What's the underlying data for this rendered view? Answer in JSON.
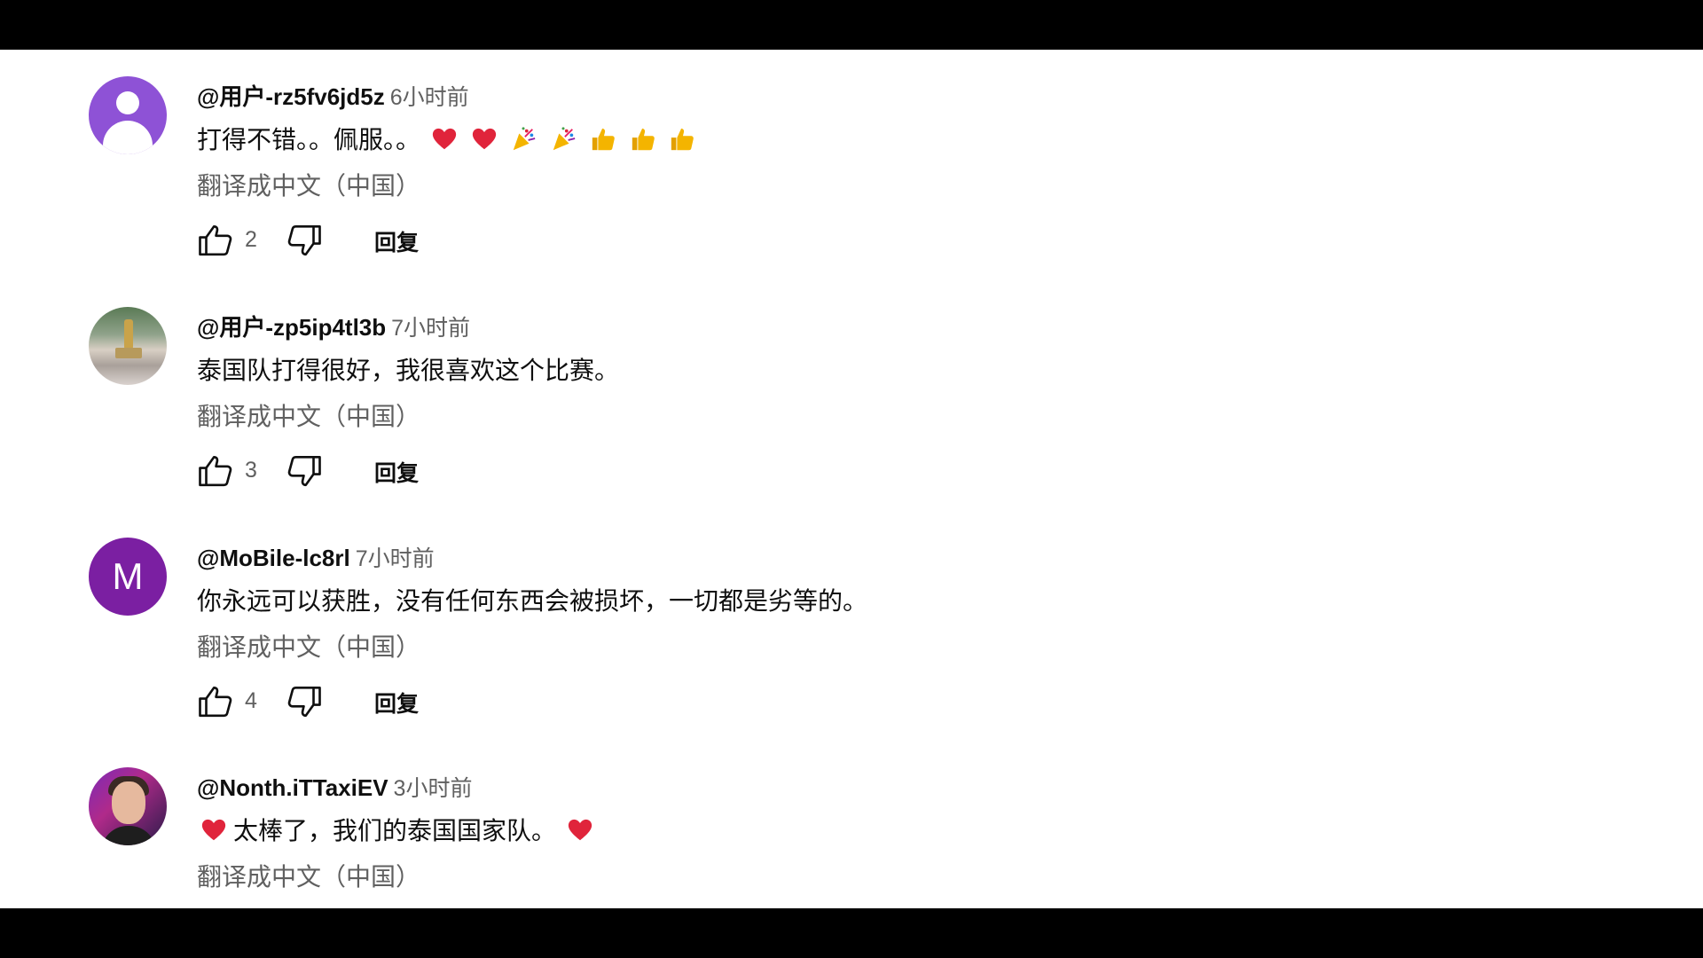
{
  "comments": [
    {
      "author": "@用户-rz5fv6jd5z",
      "time": "6小时前",
      "text": "打得不错。。佩服。。",
      "emoji_suffix": [
        "heart",
        "heart",
        "party-popper",
        "party-popper",
        "thumbs-up",
        "thumbs-up",
        "thumbs-up"
      ],
      "translate_label": "翻译成中文（中国）",
      "likes": "2",
      "reply_label": "回复",
      "avatar": "default-person-avatar"
    },
    {
      "author": "@用户-zp5ip4tl3b",
      "time": "7小时前",
      "text": "泰国队打得很好，我很喜欢这个比赛。",
      "translate_label": "翻译成中文（中国）",
      "likes": "3",
      "reply_label": "回复",
      "avatar": "photo-statue-avatar"
    },
    {
      "author": "@MoBile-lc8rl",
      "time": "7小时前",
      "text": "你永远可以获胜，没有任何东西会被损坏，一切都是劣等的。",
      "translate_label": "翻译成中文（中国）",
      "likes": "4",
      "reply_label": "回复",
      "avatar_letter": "M"
    },
    {
      "author": "@Nonth.iTTaxiEV",
      "time": "3小时前",
      "text": "太棒了，我们的泰国国家队。",
      "emoji_prefix": [
        "heart"
      ],
      "emoji_suffix": [
        "heart"
      ],
      "translate_label": "翻译成中文（中国）",
      "avatar": "photo-person-avatar"
    }
  ],
  "colors": {
    "primary_text": "#0f0f0f",
    "secondary_text": "#606060",
    "avatar_purple": "#8e52d6",
    "avatar_letter_bg": "#7b1fa2",
    "heart": "#e0243b",
    "thumb": "#f4b400"
  }
}
